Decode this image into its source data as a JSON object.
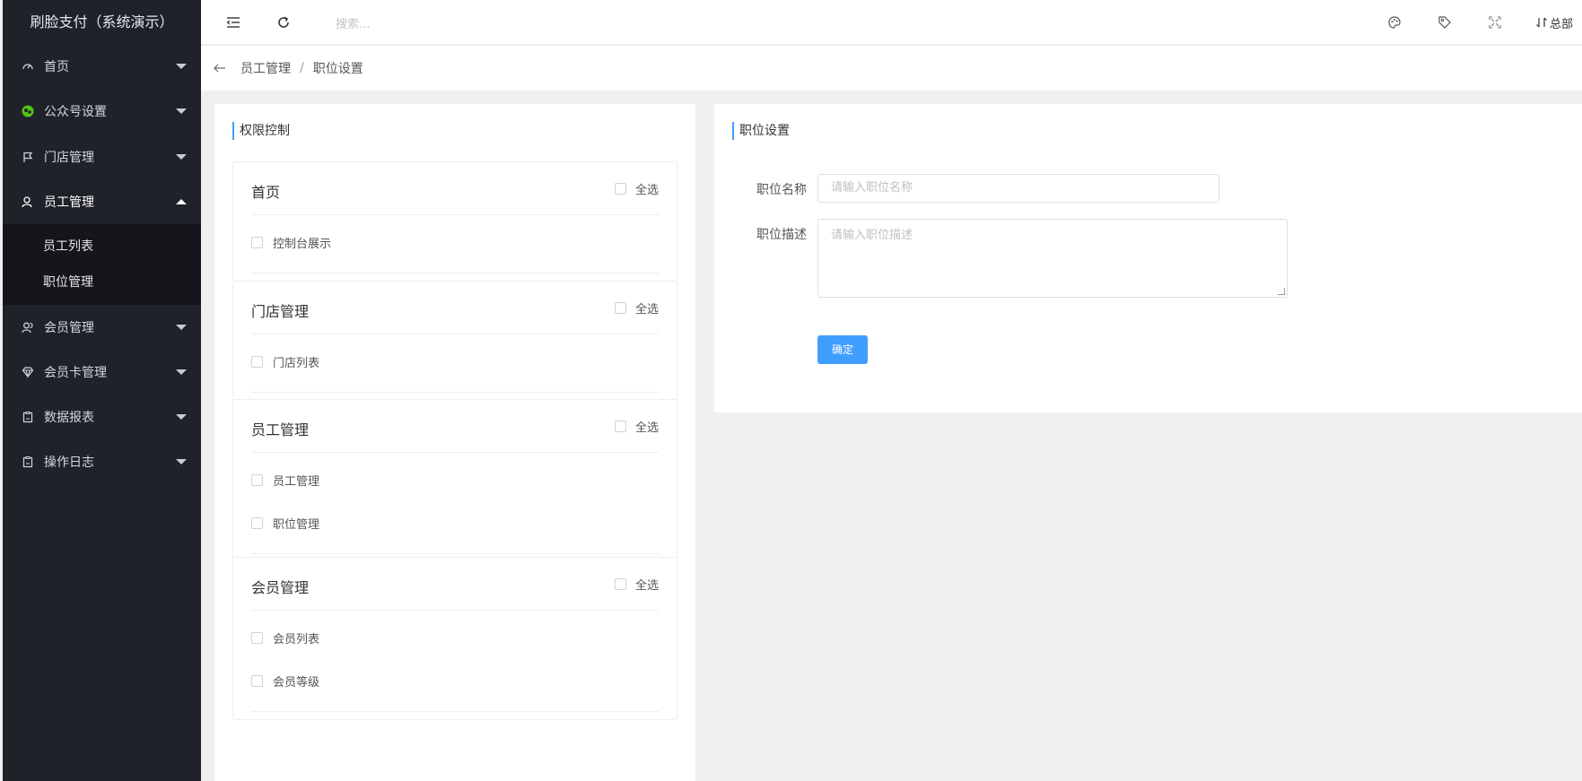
{
  "app": {
    "title": "刷脸支付（系统演示）"
  },
  "colors": {
    "sidebar_bg": "#20222a",
    "submenu_bg": "#14161b",
    "accent": "#409eff",
    "wechat_green": "#52c41a"
  },
  "sidebar": {
    "items": [
      {
        "label": "首页",
        "icon": "dashboard-icon",
        "expanded": false
      },
      {
        "label": "公众号设置",
        "icon": "wechat-icon",
        "expanded": false
      },
      {
        "label": "门店管理",
        "icon": "flag-icon",
        "expanded": false
      },
      {
        "label": "员工管理",
        "icon": "user-icon",
        "expanded": true,
        "children": [
          "员工列表",
          "职位管理"
        ]
      },
      {
        "label": "会员管理",
        "icon": "users-icon",
        "expanded": false
      },
      {
        "label": "会员卡管理",
        "icon": "diamond-icon",
        "expanded": false
      },
      {
        "label": "数据报表",
        "icon": "clipboard-icon",
        "expanded": false
      },
      {
        "label": "操作日志",
        "icon": "clipboard-icon",
        "expanded": false
      }
    ]
  },
  "topbar": {
    "search_placeholder": "搜索...",
    "org_label": "总部",
    "icons": [
      "menu-fold-icon",
      "refresh-icon",
      "palette-icon",
      "tag-icon",
      "fullscreen-icon",
      "switch-icon"
    ]
  },
  "breadcrumb": {
    "back_icon": "arrow-left-icon",
    "parent": "员工管理",
    "separator": "/",
    "current": "职位设置"
  },
  "permissions": {
    "title": "权限控制",
    "select_all_label": "全选",
    "groups": [
      {
        "title": "首页",
        "items": [
          "控制台展示"
        ]
      },
      {
        "title": "门店管理",
        "items": [
          "门店列表"
        ]
      },
      {
        "title": "员工管理",
        "items": [
          "员工管理",
          "职位管理"
        ]
      },
      {
        "title": "会员管理",
        "items": [
          "会员列表",
          "会员等级"
        ]
      }
    ]
  },
  "position_form": {
    "title": "职位设置",
    "name_label": "职位名称",
    "name_placeholder": "请输入职位名称",
    "desc_label": "职位描述",
    "desc_placeholder": "请输入职位描述",
    "confirm_label": "确定"
  }
}
